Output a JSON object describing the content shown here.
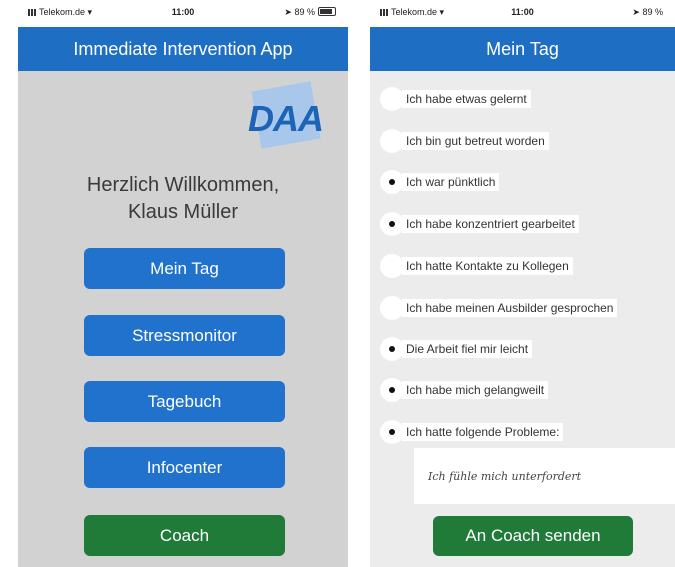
{
  "status": {
    "carrier": "Telekom.de",
    "time": "11:00",
    "battery": "89 %",
    "battery_right": "89 %"
  },
  "left": {
    "title": "Immediate Intervention App",
    "logo": "DAA",
    "welcome_line1": "Herzlich Willkommen,",
    "welcome_line2": "Klaus Müller",
    "buttons": [
      "Mein Tag",
      "Stressmonitor",
      "Tagebuch",
      "Infocenter",
      "Coach"
    ]
  },
  "right": {
    "title": "Mein Tag",
    "items": [
      {
        "label": "Ich habe etwas gelernt",
        "selected": false
      },
      {
        "label": "Ich bin gut betreut worden",
        "selected": false
      },
      {
        "label": "Ich war pünktlich",
        "selected": true
      },
      {
        "label": "Ich habe konzentriert gearbeitet",
        "selected": true
      },
      {
        "label": "Ich hatte Kontakte zu Kollegen",
        "selected": false
      },
      {
        "label": "Ich habe meinen Ausbilder gesprochen",
        "selected": false
      },
      {
        "label": "Die Arbeit fiel mir leicht",
        "selected": true
      },
      {
        "label": "Ich habe mich gelangweilt",
        "selected": true
      },
      {
        "label": "Ich hatte folgende Probleme:",
        "selected": true
      }
    ],
    "problems_text": "Ich fühle mich unterfordert",
    "send_label": "An Coach senden"
  },
  "colors": {
    "nav": "#1e6fc4",
    "primary_button": "#2072cc",
    "coach_button": "#1f7b37"
  }
}
